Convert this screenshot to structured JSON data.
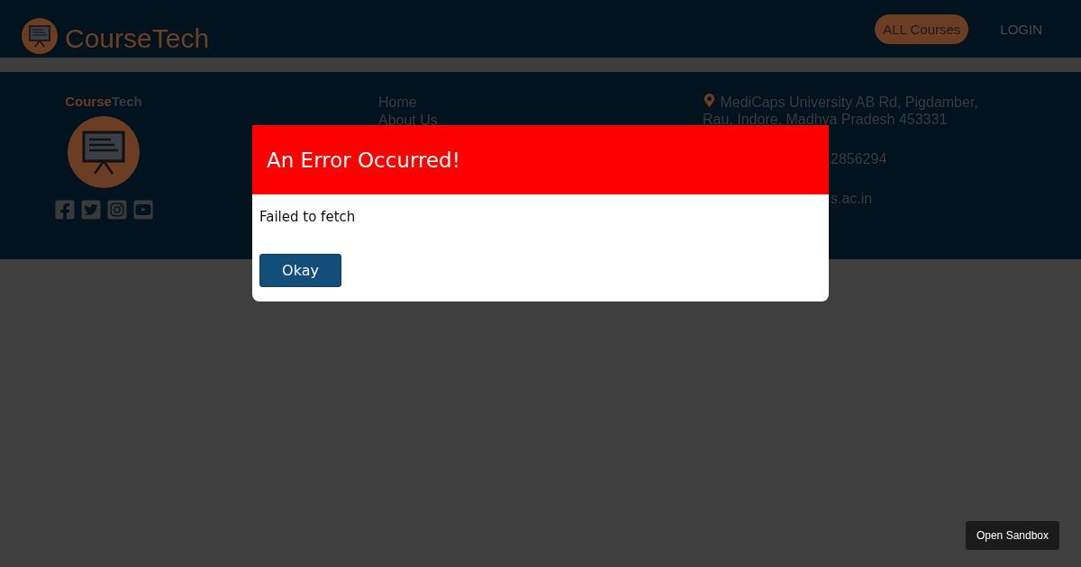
{
  "header": {
    "brand": "CourseTech",
    "nav": [
      {
        "label": "ALL Courses",
        "selected": true
      },
      {
        "label": "LOGIN",
        "selected": false
      }
    ]
  },
  "footer": {
    "brand_first": "Course",
    "brand_second": "Tech",
    "links": [
      "Home",
      "About Us"
    ],
    "address": "MediCaps University AB Rd, Pigdamber, Rau, Indore, Madhya Pradesh 453331",
    "phone": "2856294",
    "email": "s.ac.in"
  },
  "modal": {
    "title": "An Error Occurred!",
    "message": "Failed to fetch",
    "button": "Okay"
  },
  "sandbox_button": "Open Sandbox"
}
